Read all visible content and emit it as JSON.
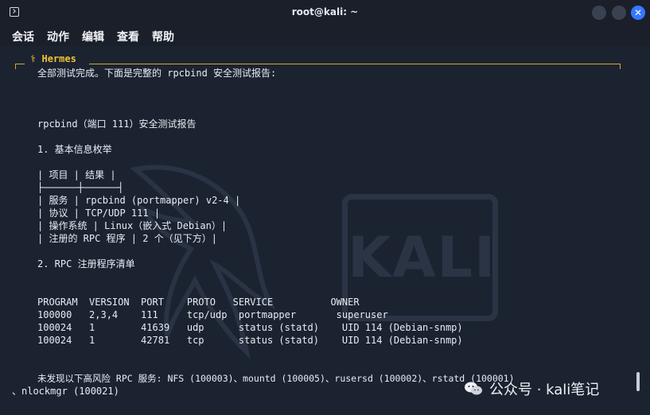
{
  "window": {
    "title": "root@kali: ~",
    "min_label": "—",
    "max_label": "□",
    "close_label": "✕"
  },
  "menu": [
    "会话",
    "动作",
    "编辑",
    "查看",
    "帮助"
  ],
  "header": {
    "agent_mark": "⚕",
    "agent_name": "Hermes"
  },
  "terminal": {
    "intro": "全部测试完成。下面是完整的 rpcbind 安全测试报告:",
    "report_title": "rpcbind（端口 111）安全测试报告",
    "section1": "1. 基本信息枚举",
    "table_header": "| 项目 | 结果 |",
    "table_rule": "├──────┼──────┤",
    "table_rows": [
      "| 服务 | rpcbind (portmapper) v2-4 |",
      "| 协议 | TCP/UDP 111 |",
      "| 操作系统 | Linux（嵌入式 Debian）|",
      "| 注册的 RPC 程序 | 2 个（见下方）|"
    ],
    "section2": "2. RPC 注册程序清单",
    "rpc_header": "PROGRAM  VERSION  PORT    PROTO   SERVICE          OWNER",
    "rpc_rows": [
      "100000   2,3,4    111     tcp/udp  portmapper       superuser",
      "100024   1        41639   udp      status (statd)    UID 114 (Debian-snmp)",
      "100024   1        42781   tcp      status (statd)    UID 114 (Debian-snmp)"
    ],
    "finding_line1": "未发现以下高风险 RPC 服务: NFS (100003)、mountd (100005)、rusersd (100002)、rstatd (100001)",
    "finding_line2": "、nlockmgr (100021)"
  },
  "watermark": {
    "kali_logo": "KALI",
    "wechat": "公众号 · kali笔记"
  },
  "colors": {
    "background": "#1b2331",
    "titlebar": "#1a1f29",
    "accent_gold": "#d9a72b",
    "close_button": "#3677ff"
  }
}
